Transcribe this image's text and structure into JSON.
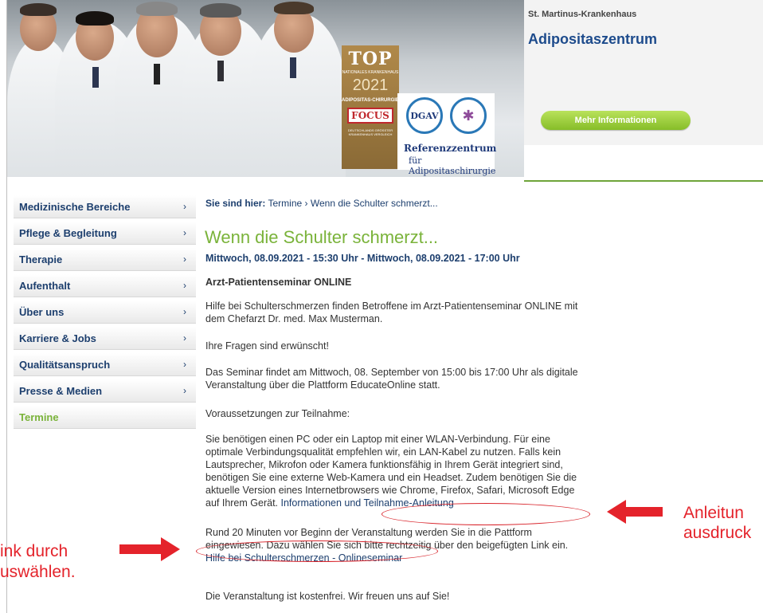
{
  "header": {
    "hospital_name": "St. Martinus-Krankenhaus",
    "centre_name": "Adipositaszentrum",
    "more_info_button": "Mehr Informationen",
    "badge_top": {
      "top": "TOP",
      "nationales": "NATIONALES KRANKENHAUS",
      "year": "2021",
      "category": "ADIPOSITAS-CHIRURGIE",
      "brand": "FOCUS",
      "footer": "DEUTSCHLANDS GRÖSSTER KRANKENHAUS VERGLEICH"
    },
    "badge_ref": {
      "dgav": "DGAV",
      "line1": "Referenzzentrum",
      "line2": "für Adipositaschirurgie"
    }
  },
  "sidebar": {
    "items": [
      {
        "label": "Medizinische Bereiche",
        "chevron": "›"
      },
      {
        "label": "Pflege & Begleitung",
        "chevron": "›"
      },
      {
        "label": "Therapie",
        "chevron": "›"
      },
      {
        "label": "Aufenthalt",
        "chevron": "›"
      },
      {
        "label": "Über uns",
        "chevron": "›"
      },
      {
        "label": "Karriere & Jobs",
        "chevron": "›"
      },
      {
        "label": "Qualitätsanspruch",
        "chevron": "›"
      },
      {
        "label": "Presse & Medien",
        "chevron": "›"
      },
      {
        "label": "Termine",
        "chevron": ""
      }
    ]
  },
  "breadcrumb": {
    "prefix": "Sie sind hier:",
    "link": "Termine",
    "separator": "›",
    "current": "Wenn die Schulter schmerzt..."
  },
  "event": {
    "title": "Wenn die Schulter schmerzt...",
    "date": "Mittwoch, 08.09.2021 - 15:30 Uhr - Mittwoch, 08.09.2021 - 17:00 Uhr",
    "subtitle": "Arzt-Patientenseminar ONLINE",
    "p1": "Hilfe bei Schulterschmerzen finden Betroffene im Arzt-Patientenseminar ONLINE mit dem Chefarzt Dr. med. Max Musterman.",
    "p2": "Ihre Fragen sind erwünscht!",
    "p3": "Das Seminar findet am Mittwoch, 08. September von 15:00 bis 17:00 Uhr als digitale Veranstaltung über die Plattform EducateOnline statt.",
    "p4": "Voraussetzungen zur Teilnahme:",
    "p5_text": "Sie benötigen einen PC oder ein Laptop mit einer WLAN-Verbindung. Für eine optimale Verbindungsqualität empfehlen wir, ein LAN-Kabel zu nutzen. Falls kein Lautsprecher, Mikrofon oder Kamera funktionsfähig in Ihrem Gerät integriert sind, benötigen Sie eine externe Web-Kamera und ein Headset. Zudem benötigen Sie die aktuelle Version eines Internetbrowsers wie Chrome, Firefox, Safari, Microsoft Edge auf Ihrem Gerät.",
    "p5_link": "Informationen und Teilnahme-Anleitung",
    "p6_text": "Rund 20 Minuten vor Beginn der Veranstaltung werden Sie in die Pattform eingewiesen. Dazu wählen Sie sich bitte rechtzeitig über den beigefügten Link ein.",
    "p6_link": "Hilfe bei Schulterschmerzen - Onlineseminar",
    "p7": "Die Veranstaltung ist kostenfrei. Wir freuen uns auf Sie!"
  },
  "annotations": {
    "right_line1": "Anleitun",
    "right_line2": "ausdruck",
    "left_line1": "ink durch",
    "left_line2": "uswählen.",
    "color": "#e4232b"
  },
  "colors": {
    "accent_green": "#7ab33a",
    "nav_blue": "#1d3f6e",
    "brand_blue": "#1d4b8c"
  }
}
